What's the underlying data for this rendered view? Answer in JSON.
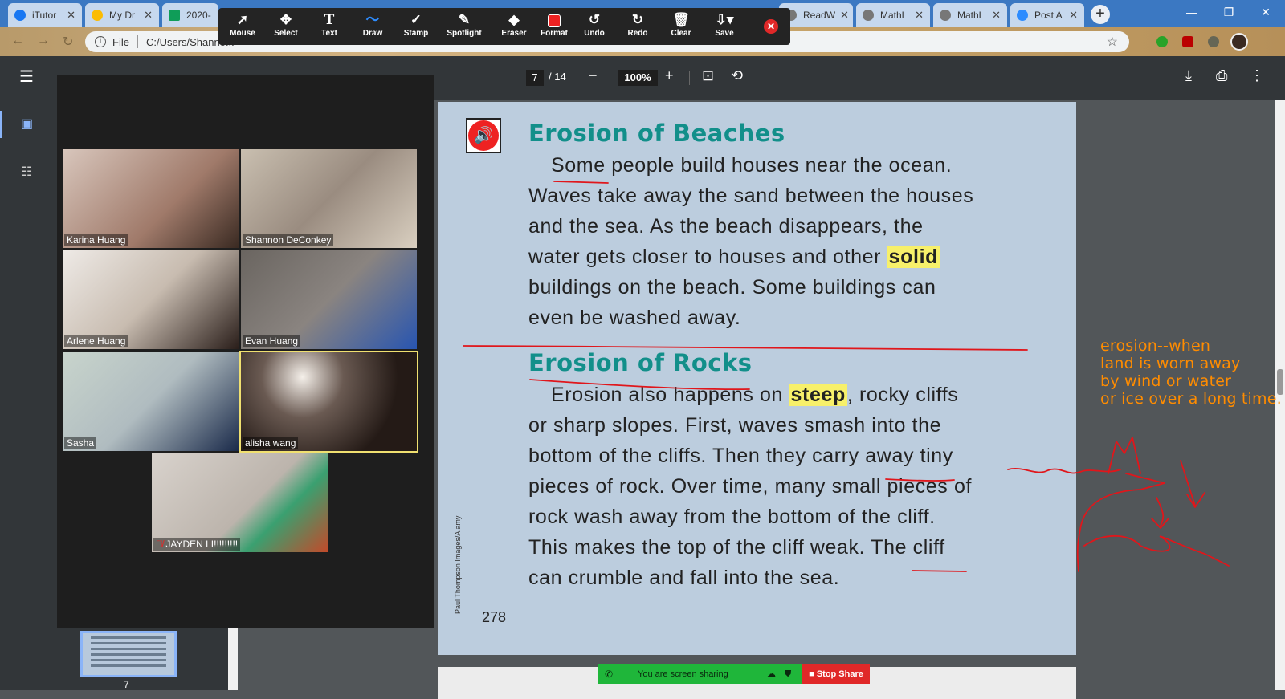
{
  "browser": {
    "tabs": [
      {
        "label": "iTutor",
        "color": "#1877f2"
      },
      {
        "label": "My Dr",
        "color": "#fbbc04"
      },
      {
        "label": "2020-",
        "color": "#0f9d58"
      },
      {
        "label": "ReadW",
        "color": "#777777"
      },
      {
        "label": "MathL",
        "color": "#777777"
      },
      {
        "label": "MathL",
        "color": "#777777"
      },
      {
        "label": "Post A",
        "color": "#2d8cff"
      }
    ],
    "address_scheme": "File",
    "address": "C:/Users/Shanno..."
  },
  "annotation_toolbar": {
    "tools": [
      {
        "label": "Mouse",
        "icon": "cursor-icon"
      },
      {
        "label": "Select",
        "icon": "move-icon"
      },
      {
        "label": "Text",
        "icon": "text-icon"
      },
      {
        "label": "Draw",
        "icon": "squiggle-icon"
      },
      {
        "label": "Stamp",
        "icon": "check-icon"
      },
      {
        "label": "Spotlight",
        "icon": "wand-icon"
      },
      {
        "label": "Eraser",
        "icon": "eraser-icon"
      },
      {
        "label": "Format",
        "icon": "red-square-icon"
      },
      {
        "label": "Undo",
        "icon": "undo-icon"
      },
      {
        "label": "Redo",
        "icon": "redo-icon"
      },
      {
        "label": "Clear",
        "icon": "trash-icon"
      },
      {
        "label": "Save",
        "icon": "save-icon"
      }
    ],
    "active": "Draw"
  },
  "pdf": {
    "page_current": "7",
    "page_total": "/ 14",
    "zoom": "100%",
    "thumbnail_number": "7"
  },
  "page": {
    "heading1": "Erosion of Beaches",
    "para1": {
      "pre": "Some people build houses near the ocean. Waves take away the sand between the houses and the sea. As the beach disappears, the water gets closer to houses and other ",
      "highlight": "solid",
      "post": " buildings on the beach. Some buildings can even be washed away."
    },
    "heading2": "Erosion of Rocks",
    "para2": {
      "pre": "Erosion also happens on ",
      "highlight": "steep",
      "post": ", rocky cliffs or sharp slopes. First, waves smash into the bottom of the cliffs. Then they carry away tiny pieces of rock. Over time, many small pieces of rock wash away from the bottom of the cliff. This makes the top of the cliff weak. The cliff can crumble and fall into the sea."
    },
    "credit": "Paul Thompson Images/Alamy",
    "page_number": "278"
  },
  "annotation_note": "erosion--when\nland is worn away\nby wind or water\nor ice over a long time.",
  "gallery": {
    "participants": [
      {
        "name": "Karina Huang",
        "bg": "#c9a89a"
      },
      {
        "name": "Shannon DeConkey",
        "bg": "#b8aa9e"
      },
      {
        "name": "Arlene Huang",
        "bg": "#d9d2cc"
      },
      {
        "name": "Evan Huang",
        "bg": "#7a7570"
      },
      {
        "name": "Sasha",
        "bg": "#b9c6c0"
      },
      {
        "name": "alisha wang",
        "bg": "#3a2e2a"
      },
      {
        "name": "JAYDEN LI!!!!!!!!!",
        "bg": "#c8c2bc"
      }
    ]
  },
  "share_banner": {
    "status": "You are screen sharing",
    "stop": "Stop Share"
  }
}
